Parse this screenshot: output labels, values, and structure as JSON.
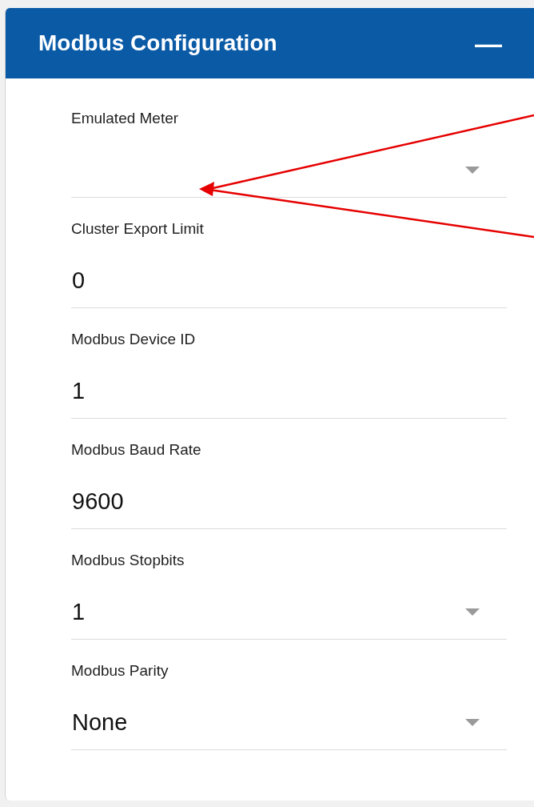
{
  "panel": {
    "title": "Modbus Configuration",
    "collapse_symbol": "—"
  },
  "fields": [
    {
      "kind": "select",
      "label": "Emulated Meter"
    },
    {
      "kind": "input",
      "label": "Cluster Export Limit",
      "value": "0"
    },
    {
      "kind": "input",
      "label": "Modbus Device ID",
      "value": "1"
    },
    {
      "kind": "input",
      "label": "Modbus Baud Rate",
      "value": "9600"
    },
    {
      "kind": "select",
      "label": "Modbus Stopbits",
      "value": "1"
    },
    {
      "kind": "select",
      "label": "Modbus Parity",
      "value": "None"
    }
  ]
}
